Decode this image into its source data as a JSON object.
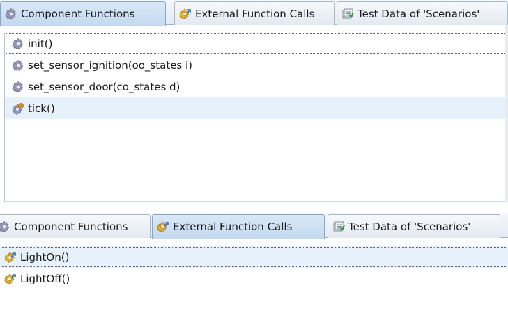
{
  "top_panel": {
    "tabs": [
      {
        "label": "Component Functions",
        "icon": "gear-icon",
        "active": true
      },
      {
        "label": "External Function Calls",
        "icon": "external-call-icon",
        "active": false
      },
      {
        "label": "Test Data of 'Scenarios'",
        "icon": "test-data-icon",
        "active": false
      }
    ],
    "items": [
      {
        "label": "init()",
        "icon": "gear-icon"
      },
      {
        "label": "set_sensor_ignition(oo_states i)",
        "icon": "gear-icon"
      },
      {
        "label": "set_sensor_door(co_states d)",
        "icon": "gear-icon"
      },
      {
        "label": "tick()",
        "icon": "gear-call-icon"
      }
    ]
  },
  "bottom_panel": {
    "tabs": [
      {
        "label": "Component Functions",
        "icon": "gear-icon",
        "active": false
      },
      {
        "label": "External Function Calls",
        "icon": "external-call-icon",
        "active": true
      },
      {
        "label": "Test Data of 'Scenarios'",
        "icon": "test-data-icon",
        "active": false
      }
    ],
    "items": [
      {
        "label": "LightOn()",
        "icon": "external-call-icon"
      },
      {
        "label": "LightOff()",
        "icon": "external-call-icon"
      }
    ]
  }
}
